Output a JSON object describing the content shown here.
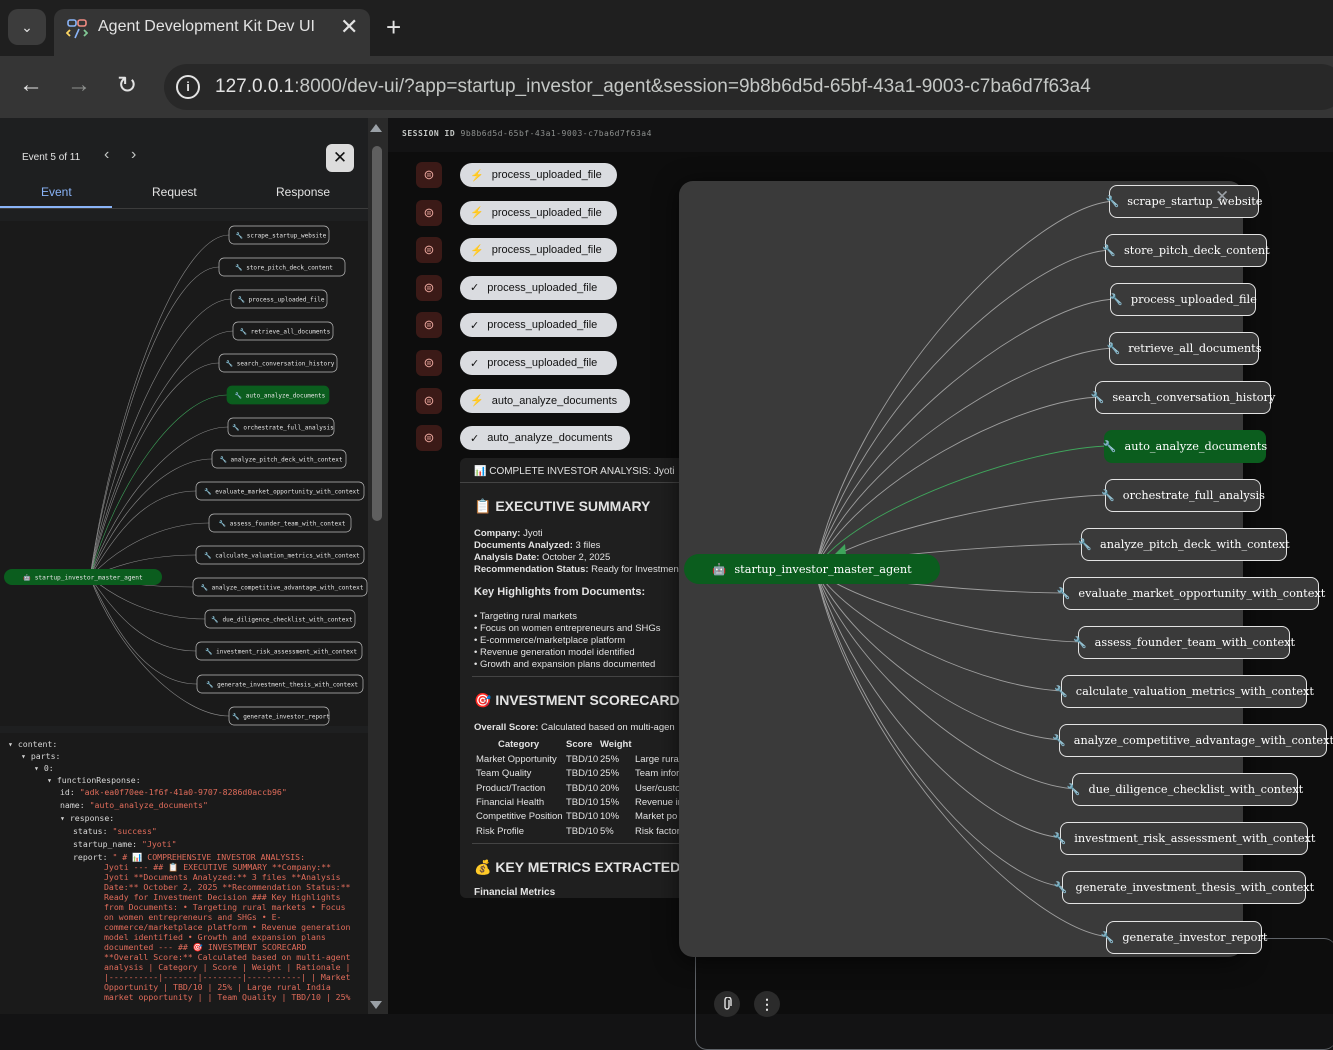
{
  "browser": {
    "tab_title": "Agent Development Kit Dev UI",
    "tab_close": "✕",
    "new_tab": "+",
    "tab_menu": "⌄",
    "back": "←",
    "forward": "→",
    "reload": "↻",
    "info": "i",
    "url_host": "127.0.0.1",
    "url_rest": ":8000/dev-ui/?app=startup_investor_agent&session=9b8b6d5d-65bf-43a1-9003-c7ba6d7f63a4"
  },
  "event_panel": {
    "counter": "Event 5 of 11",
    "prev": "‹",
    "next": "›",
    "close": "✕",
    "tabs": [
      "Event",
      "Request",
      "Response"
    ],
    "active_tab": "Event"
  },
  "graph": {
    "root": "startup_investor_master_agent",
    "root_icon": "robot-icon",
    "tool_icon": "wrench-icon",
    "active": "auto_analyze_documents",
    "tools": [
      "scrape_startup_website",
      "store_pitch_deck_content",
      "process_uploaded_file",
      "retrieve_all_documents",
      "search_conversation_history",
      "auto_analyze_documents",
      "orchestrate_full_analysis",
      "analyze_pitch_deck_with_context",
      "evaluate_market_opportunity_with_context",
      "assess_founder_team_with_context",
      "calculate_valuation_metrics_with_context",
      "analyze_competitive_advantage_with_context",
      "due_diligence_checklist_with_context",
      "investment_risk_assessment_with_context",
      "generate_investment_thesis_with_context",
      "generate_investor_report"
    ],
    "colors": {
      "active": "#0b5d1e",
      "edge": "#9e9e9e",
      "edge_active": "#3fa55b"
    }
  },
  "json_view": {
    "lines": [
      {
        "indent": 0,
        "key": "content",
        "value": ""
      },
      {
        "indent": 1,
        "key": "parts",
        "value": ""
      },
      {
        "indent": 2,
        "key": "0",
        "value": ""
      },
      {
        "indent": 3,
        "key": "functionResponse",
        "value": ""
      },
      {
        "indent": 4,
        "key": "id",
        "value": "\"adk-ea0f70ee-1f6f-41a0-9707-8286d0accb96\""
      },
      {
        "indent": 4,
        "key": "name",
        "value": "\"auto_analyze_documents\""
      },
      {
        "indent": 4,
        "key": "response",
        "value": ""
      },
      {
        "indent": 5,
        "key": "status",
        "value": "\"success\""
      },
      {
        "indent": 5,
        "key": "startup_name",
        "value": "\"Jyoti\""
      },
      {
        "indent": 5,
        "key": "report",
        "value": "\" # 📊 COMPREHENSIVE INVESTOR ANALYSIS:"
      }
    ],
    "report_lines": [
      "Jyoti --- ## 📋 EXECUTIVE SUMMARY **Company:**",
      "Jyoti **Documents Analyzed:** 3 files **Analysis",
      "Date:** October 2, 2025 **Recommendation Status:**",
      "Ready for Investment Decision ### Key Highlights",
      "from Documents: • Targeting rural markets • Focus",
      "on women entrepreneurs and SHGs • E-",
      "commerce/marketplace platform • Revenue generation",
      "model identified • Growth and expansion plans",
      "documented --- ## 🎯 INVESTMENT SCORECARD",
      "**Overall Score:** Calculated based on multi-agent",
      "analysis | Category | Score | Weight | Rationale |",
      "|----------|-------|--------|-----------| | Market",
      "Opportunity | TBD/10 | 25% | Large rural India",
      "market opportunity | | Team Quality | TBD/10 | 25%"
    ]
  },
  "session": {
    "label": "SESSION ID",
    "id": "9b8b6d5d-65bf-43a1-9003-c7ba6d7f63a4"
  },
  "chat_events": [
    {
      "icon": "⚡",
      "label": "process_uploaded_file"
    },
    {
      "icon": "⚡",
      "label": "process_uploaded_file"
    },
    {
      "icon": "⚡",
      "label": "process_uploaded_file"
    },
    {
      "icon": "✓",
      "label": "process_uploaded_file"
    },
    {
      "icon": "✓",
      "label": "process_uploaded_file"
    },
    {
      "icon": "✓",
      "label": "process_uploaded_file"
    },
    {
      "icon": "⚡",
      "label": "auto_analyze_documents"
    },
    {
      "icon": "✓",
      "label": "auto_analyze_documents"
    }
  ],
  "report": {
    "header": "📊 COMPLETE INVESTOR ANALYSIS: Jyoti",
    "exec_title": "📋 EXECUTIVE SUMMARY",
    "company_k": "Company:",
    "company_v": " Jyoti",
    "docs_k": "Documents Analyzed:",
    "docs_v": " 3 files",
    "date_k": "Analysis Date:",
    "date_v": " October 2, 2025",
    "rec_k": "Recommendation Status:",
    "rec_v": " Ready for Investment",
    "highlights_title": "Key Highlights from Documents:",
    "highlights": [
      "• Targeting rural markets",
      "• Focus on women entrepreneurs and SHGs",
      "• E-commerce/marketplace platform",
      "• Revenue generation model identified",
      "• Growth and expansion plans documented"
    ],
    "scorecard_title": "🎯 INVESTMENT SCORECARD",
    "overall_k": "Overall Score:",
    "overall_v": " Calculated based on multi-agen",
    "table_headers": [
      "Category",
      "Score",
      "Weight",
      ""
    ],
    "table_rows": [
      [
        "Market Opportunity",
        "TBD/10",
        "25%",
        "Large rura"
      ],
      [
        "Team Quality",
        "TBD/10",
        "25%",
        "Team infor"
      ],
      [
        "Product/Traction",
        "TBD/10",
        "20%",
        "User/custo"
      ],
      [
        "Financial Health",
        "TBD/10",
        "15%",
        "Revenue ir"
      ],
      [
        "Competitive Position",
        "TBD/10",
        "10%",
        "Market po"
      ],
      [
        "Risk Profile",
        "TBD/10",
        "5%",
        "Risk factor"
      ]
    ],
    "metrics_title": "💰 KEY METRICS EXTRACTED",
    "metrics_sub": "Financial Metrics"
  },
  "overlay": {
    "close": "✕"
  },
  "input": {
    "attach_icon": "paperclip-icon",
    "more": "⋮"
  }
}
